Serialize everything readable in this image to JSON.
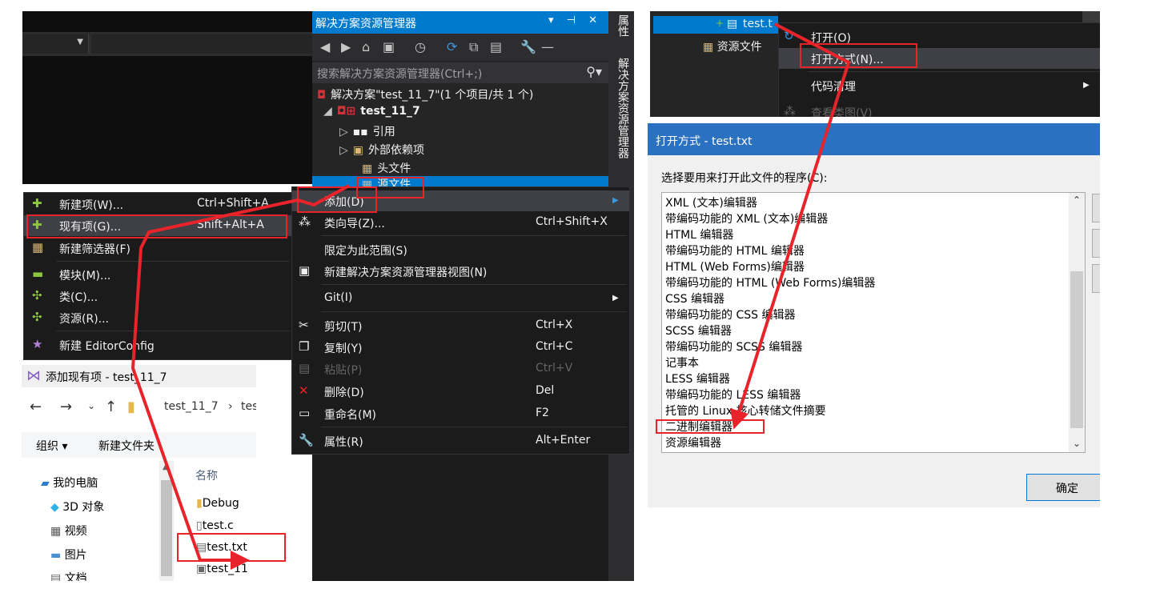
{
  "solution_explorer": {
    "title": "解决方案资源管理器",
    "title_controls": "▾ ⊣ ✕",
    "search_placeholder": "搜索解决方案资源管理器(Ctrl+;)",
    "solution_label": "解决方案\"test_11_7\"(1 个项目/共 1 个)",
    "project_label": "test_11_7",
    "nodes": [
      "引用",
      "外部依赖项",
      "头文件",
      "源文件"
    ]
  },
  "side_tabs": {
    "properties": "属性",
    "solution_explorer": "解决方案资源管理器"
  },
  "add_submenu": {
    "items": [
      {
        "label": "新建项(W)...",
        "shortcut": "Ctrl+Shift+A"
      },
      {
        "label": "现有项(G)...",
        "shortcut": "Shift+Alt+A"
      },
      {
        "label": "新建筛选器(F)",
        "shortcut": ""
      },
      {
        "label": "模块(M)...",
        "shortcut": ""
      },
      {
        "label": "类(C)...",
        "shortcut": ""
      },
      {
        "label": "资源(R)...",
        "shortcut": ""
      },
      {
        "label": "新建 EditorConfig",
        "shortcut": ""
      }
    ]
  },
  "context_menu": {
    "items": [
      {
        "label": "添加(D)",
        "shortcut": ""
      },
      {
        "label": "类向导(Z)...",
        "shortcut": "Ctrl+Shift+X"
      },
      {
        "label": "限定为此范围(S)",
        "shortcut": ""
      },
      {
        "label": "新建解决方案资源管理器视图(N)",
        "shortcut": ""
      },
      {
        "label": "Git(I)",
        "shortcut": ""
      },
      {
        "label": "剪切(T)",
        "shortcut": "Ctrl+X"
      },
      {
        "label": "复制(Y)",
        "shortcut": "Ctrl+C"
      },
      {
        "label": "粘贴(P)",
        "shortcut": "Ctrl+V"
      },
      {
        "label": "删除(D)",
        "shortcut": "Del"
      },
      {
        "label": "重命名(M)",
        "shortcut": "F2"
      },
      {
        "label": "属性(R)",
        "shortcut": "Alt+Enter"
      }
    ]
  },
  "add_existing_dialog": {
    "title": "添加现有项 - test_11_7",
    "path": [
      "test_11_7",
      "test"
    ],
    "organize": "组织 ▾",
    "new_folder": "新建文件夹",
    "nav_items": [
      "我的电脑",
      "3D 对象",
      "视频",
      "图片",
      "文档"
    ],
    "column_name": "名称",
    "files": [
      "Debug",
      "test.c",
      "test.txt",
      "test_11"
    ]
  },
  "file_context": {
    "file_label": "test.t",
    "resources_label": "资源文件",
    "items": [
      {
        "label": "打开(O)"
      },
      {
        "label": "打开方式(N)..."
      },
      {
        "label": "代码清理"
      },
      {
        "label": "查看类图(V)"
      }
    ]
  },
  "open_with_dialog": {
    "title": "打开方式 - test.txt",
    "prompt": "选择要用来打开此文件的程序(C):",
    "editors": [
      "XML (文本)编辑器",
      "带编码功能的 XML (文本)编辑器",
      "HTML 编辑器",
      "带编码功能的 HTML 编辑器",
      "HTML (Web Forms)编辑器",
      "带编码功能的 HTML (Web Forms)编辑器",
      "CSS 编辑器",
      "带编码功能的 CSS 编辑器",
      "SCSS 编辑器",
      "带编码功能的 SCSS 编辑器",
      "记事本",
      "LESS 编辑器",
      "带编码功能的 LESS 编辑器",
      "托管的 Linux 核心转储文件摘要",
      "二进制编辑器",
      "资源编辑器"
    ],
    "ok_label": "确定"
  },
  "colors": {
    "accent": "#007acc",
    "annotation": "#e8242a",
    "menu_bg": "#1b1b1c"
  }
}
